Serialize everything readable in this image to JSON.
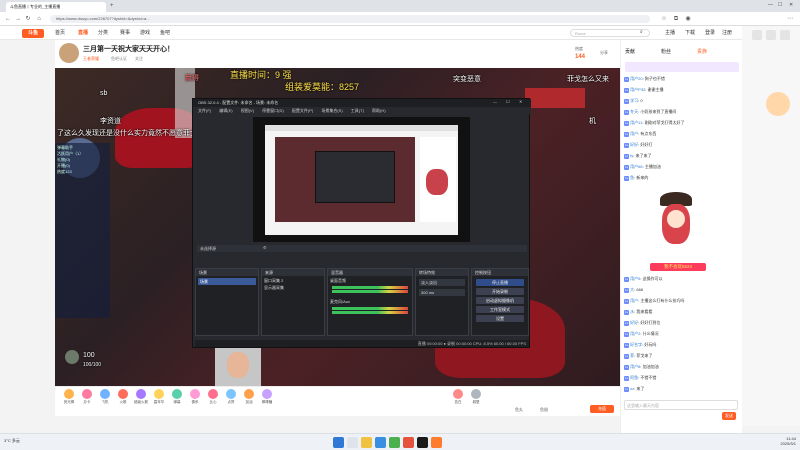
{
  "browser": {
    "tab_title": "斗鱼直播丨专业的_主播直播",
    "tab2_title": "",
    "url": "https://www.douyu.com/226707?dyshid=&dyshci=a..."
  },
  "site": {
    "logo": "斗鱼",
    "nav": [
      "首页",
      "直播",
      "分类",
      "赛事",
      "游戏",
      "鱼吧"
    ],
    "search_placeholder": "Rome",
    "header_right": [
      "主播",
      "下载",
      "登录",
      "注册"
    ]
  },
  "room": {
    "title": "三月第一天祝大家天天开心！",
    "sub1": "王者荣耀",
    "sub2": "鱼吧认证",
    "sub3": "关注",
    "meta": [
      "热度",
      "144",
      "分享"
    ]
  },
  "video": {
    "danmu": [
      "赢得",
      "直播时间：9 强",
      "组装爱莫能：8257",
      "突变恶意",
      "菲戈怎么又来",
      "sb",
      "了这么久发现还是没什么实力竟然不愿意菲戈打",
      "李资道",
      "机"
    ],
    "overlay_lines": [
      "弹幕助手",
      "活跃用户（1）",
      "礼物(0)",
      "开播(0)",
      "热度123"
    ],
    "hp_value": "100",
    "lower_text": "100/100"
  },
  "obs": {
    "title": "OBS 32.0.4 - 配置文件: 未命名 - 场景: 未命名",
    "menu": [
      "文件(F)",
      "编辑(E)",
      "视图(V)",
      "停靠窗口(D)",
      "配置文件(P)",
      "场景集合(S)",
      "工具(T)",
      "帮助(H)"
    ],
    "source_bar": "未选择源",
    "panels": [
      "场景",
      "来源",
      "混音器",
      "转场特效",
      "控制按钮"
    ],
    "scene_item": "场景",
    "sources": [
      "窗口采集 2",
      "显示器采集"
    ],
    "mixer": [
      "桌面音频",
      "麦克风/Aux"
    ],
    "transition": [
      "淡入淡出",
      "300 ms"
    ],
    "controls": [
      "停止直播",
      "开始录制",
      "启动虚拟摄像机",
      "工作室模式",
      "设置"
    ],
    "status": "直播 00:00:00 ● 录制 00:00:00 CPU: 8.5% 60.00 / 60.00 FPS"
  },
  "chat": {
    "header": [
      "贡献",
      "粉丝",
      "贵族"
    ],
    "lines": [
      {
        "name": "用户20",
        "text": "狗子也不错"
      },
      {
        "name": "用户P32",
        "text": "谢谢主播"
      },
      {
        "name": "学习",
        "text": "0"
      },
      {
        "name": "冬天",
        "text": "小奶孩来到了直播间"
      },
      {
        "name": "用户11",
        "text": "刚刚对菲戈打得太好了"
      },
      {
        "name": "用户",
        "text": "有点东西"
      },
      {
        "name": "好好",
        "text": "好好打"
      },
      {
        "name": "fy",
        "text": "来了来了"
      },
      {
        "name": "用户66",
        "text": "主播加油"
      },
      {
        "name": "鱼",
        "text": "新来的"
      },
      {
        "name": "用户5",
        "text": "这操作可以"
      },
      {
        "name": "大",
        "text": "666"
      },
      {
        "name": "用户",
        "text": "主播这么打有什么技巧吗"
      },
      {
        "name": "水",
        "text": "我来看看"
      },
      {
        "name": "好好",
        "text": "好好打到位"
      },
      {
        "name": "用户2",
        "text": "什么情况"
      },
      {
        "name": "好名字",
        "text": "好玩吗"
      },
      {
        "name": "菲",
        "text": "菲戈来了"
      },
      {
        "name": "用户8",
        "text": "加油加油"
      },
      {
        "name": "阿鱼",
        "text": "不错不错"
      },
      {
        "name": "zz",
        "text": "来了"
      },
      {
        "name": "用户",
        "text": "哈哈哈哈哈"
      }
    ],
    "badge": "我不会玩5524",
    "input_placeholder": "这里输入聊天内容",
    "send_label": "发送"
  },
  "gifts": [
    "荧光棒",
    "办卡",
    "飞机",
    "火箭",
    "超级火箭",
    "嘉年华",
    "弹幕",
    "佛系",
    "比心",
    "点赞",
    "加油",
    "棒棒糖",
    "告白",
    "城堡"
  ],
  "giftbar_bottom": [
    "鱼丸",
    "鱼翅",
    "充值"
  ],
  "taskbar": {
    "weather": "3°C 多云",
    "time": "11:44",
    "date": "2025/3/1"
  }
}
